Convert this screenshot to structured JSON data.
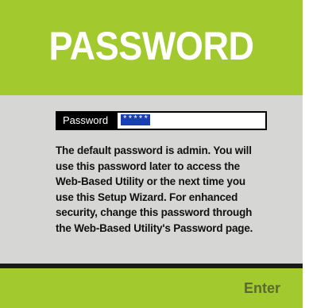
{
  "header": {
    "title": "PASSWORD"
  },
  "password_field": {
    "label": "Password",
    "value": "*****"
  },
  "description": {
    "lines": [
      [
        "The default password is ",
        "admin",
        ".  You will"
      ],
      "use this password later to access the",
      "Web-Based Utility or the next time you",
      "use this Setup Wizard. For enhanced",
      "security, change this password through",
      "the Web-Based Utility's Password page."
    ]
  },
  "footer": {
    "enter_label": "Enter"
  },
  "colors": {
    "accent_green": "#a2c92e",
    "panel_gray": "#d6d6d4",
    "selection_blue": "#1a3fb2"
  }
}
